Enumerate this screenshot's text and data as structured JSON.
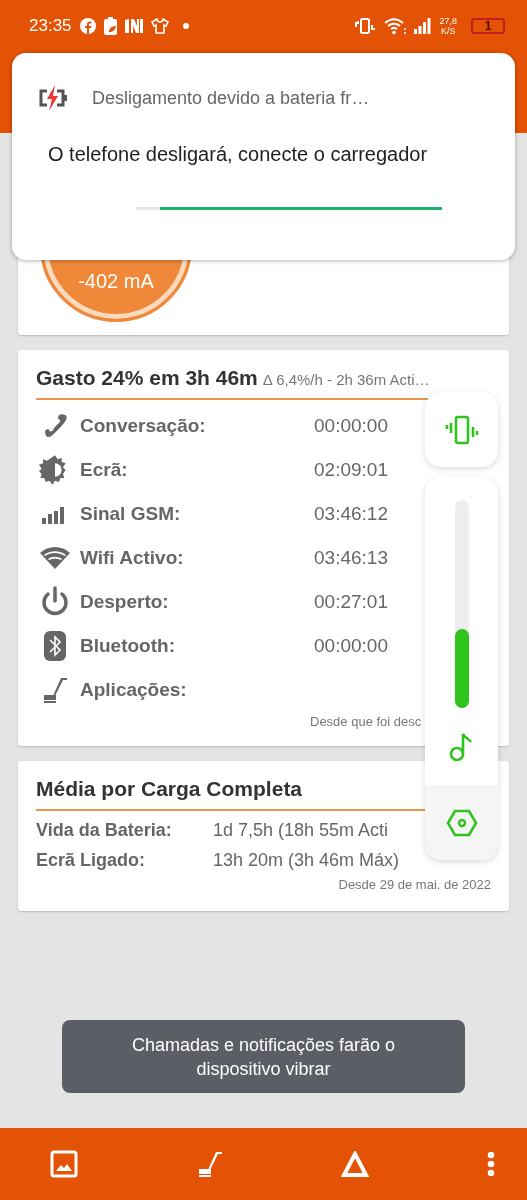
{
  "status_bar": {
    "time": "23:35",
    "speed_value": "27,8",
    "speed_unit": "K/S",
    "battery": "1"
  },
  "current_card": {
    "reading": "-402 mA"
  },
  "usage_card": {
    "title": "Gasto 24% em 3h 46m",
    "subtitle": "Δ 6,4%/h - 2h 36m Acti…",
    "rows": [
      {
        "label": "Conversação:",
        "value": "00:00:00"
      },
      {
        "label": "Ecrã:",
        "value": "02:09:01"
      },
      {
        "label": "Sinal GSM:",
        "value": "03:46:12"
      },
      {
        "label": "Wifi Activo:",
        "value": "03:46:13"
      },
      {
        "label": "Desperto:",
        "value": "00:27:01"
      },
      {
        "label": "Bluetooth:",
        "value": "00:00:00"
      },
      {
        "label": "Aplicações:"
      }
    ],
    "footer": "Desde que foi desc"
  },
  "average_card": {
    "title": "Média por Carga Completa",
    "rows": [
      {
        "label": "Vida da Bateria:",
        "value": "1d 7,5h (18h 55m Acti"
      },
      {
        "label": "Ecrã Ligado:",
        "value": "13h 20m (3h 46m Máx)"
      }
    ],
    "footer": "Desde 29 de mai. de 2022"
  },
  "notification": {
    "title": "Desligamento devido a bateria fr…",
    "body": "O telefone desligará, conecte o carregador",
    "progress": {
      "level": 0.92
    }
  },
  "volume_panel": {
    "level": 0.38
  },
  "toast": {
    "text": "Chamadas e notificações farão o dispositivo vibrar"
  }
}
